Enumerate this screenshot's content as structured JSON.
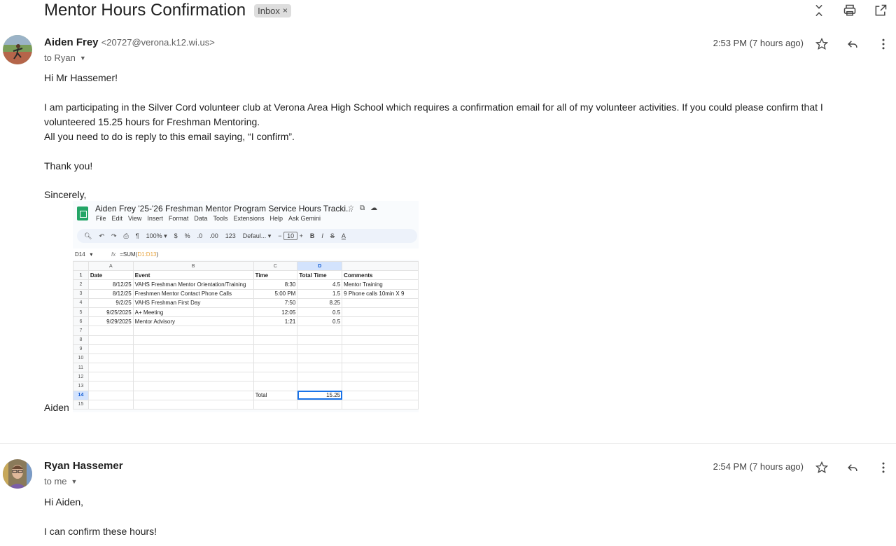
{
  "thread": {
    "subject": "Mentor Hours Confirmation",
    "label": "Inbox",
    "label_remove": "×"
  },
  "icons": {
    "collapse": "collapse-icon",
    "print": "print-icon",
    "popout": "open-in-new-window-icon",
    "star": "star-icon",
    "reply": "reply-icon",
    "more": "more-vert-icon"
  },
  "message1": {
    "sender_name": "Aiden Frey",
    "sender_email": "<20727@verona.k12.wi.us>",
    "to": "to Ryan",
    "time": "2:53 PM (7 hours ago)",
    "greeting": "Hi Mr Hassemer!",
    "para1": "I am participating in the Silver Cord volunteer club at Verona Area High School which requires a confirmation email for all of my volunteer activities. If you could please confirm that I volunteered 15.25 hours for Freshman Mentoring.",
    "para2": "All you need to do is reply to this email saying, “I confirm”.",
    "thanks": "Thank you!",
    "closing": "Sincerely,",
    "signature": "Aiden"
  },
  "sheet": {
    "title": "Aiden Frey '25-'26 Freshman Mentor Program Service Hours Tracki...",
    "menu": [
      "File",
      "Edit",
      "View",
      "Insert",
      "Format",
      "Data",
      "Tools",
      "Extensions",
      "Help",
      "Ask Gemini"
    ],
    "zoom": "100%",
    "toolbar_currency": "$",
    "toolbar_percent": "%",
    "toolbar_dec_dec": ".0",
    "toolbar_dec_inc": ".00",
    "toolbar_numfmt": "123",
    "font": "Defaul...",
    "font_size": "10",
    "cell_ref": "D14",
    "formula_prefix": "=SUM(",
    "formula_range": "D1:D13",
    "formula_suffix": ")",
    "col_headers": [
      "A",
      "B",
      "C",
      "D",
      ""
    ],
    "header_row": [
      "Date",
      "Event",
      "Time",
      "Total Time",
      "Comments"
    ],
    "rows": [
      [
        "8/12/25",
        "VAHS Freshman Mentor Orientation/Training",
        "8:30",
        "4.5",
        "Mentor Training"
      ],
      [
        "8/12/25",
        "Freshmen Mentor Contact Phone Calls",
        "5:00 PM",
        "1.5",
        "9 Phone calls 10min X 9"
      ],
      [
        "9/2/25",
        "VAHS Freshman First Day",
        "7:50",
        "8.25",
        ""
      ],
      [
        "9/25/2025",
        "A+ Meeting",
        "12:05",
        "0.5",
        ""
      ],
      [
        "9/29/2025",
        "Mentor Advisory",
        "1:21",
        "0.5",
        ""
      ]
    ],
    "total_label": "Total",
    "total_value": "15.25"
  },
  "message2": {
    "sender_name": "Ryan Hassemer",
    "to": "to me",
    "time": "2:54 PM (7 hours ago)",
    "greeting": "Hi Aiden,",
    "line1": "I can confirm these hours!"
  }
}
